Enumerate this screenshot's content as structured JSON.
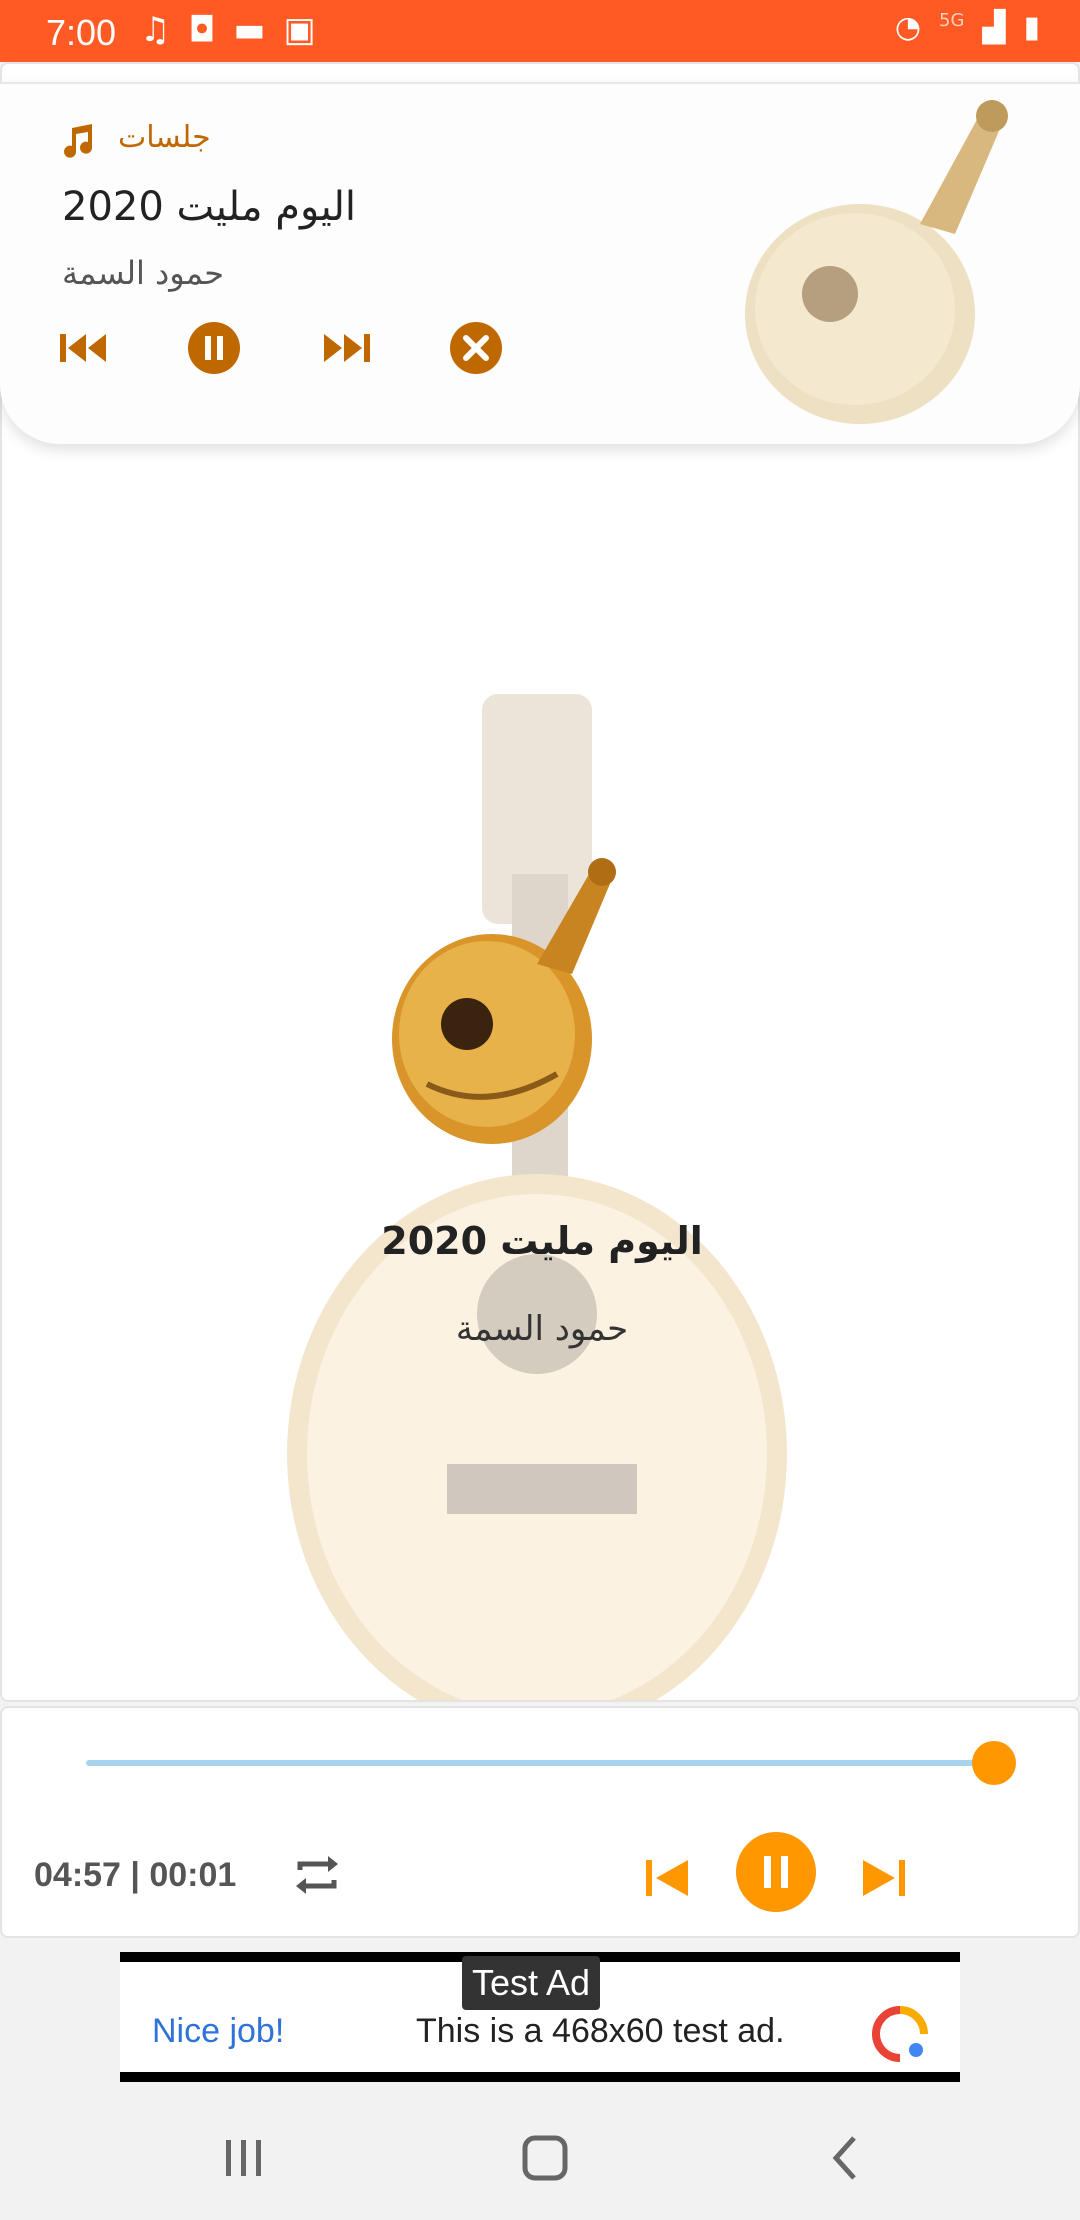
{
  "status_bar": {
    "time": "7:00",
    "left_icons": [
      "music-note-icon",
      "shopping-bag-icon",
      "chat-bubble-icon",
      "image-icon"
    ],
    "right_icons": [
      "wifi-icon",
      "5g-icon",
      "signal-icon",
      "battery-charging-icon"
    ]
  },
  "notification": {
    "app_name": "جلسات",
    "title": "2020 اليوم مليت",
    "artist": "حمود السمة",
    "controls": [
      "skip-previous-icon",
      "pause-icon",
      "skip-next-icon",
      "close-icon"
    ]
  },
  "main": {
    "title": "2020 اليوم مليت",
    "artist": "حمود السمة"
  },
  "player": {
    "time_display": "04:57 | 00:01",
    "progress": 0.97,
    "accent_color": "#ff9800",
    "track_color": "#a8d4f0"
  },
  "ad": {
    "tag": "Test Ad",
    "cta": "Nice job!",
    "text": "This is a 468x60 test ad."
  },
  "colors": {
    "status_bar": "#ff5a24",
    "notif_accent": "#c06800"
  }
}
